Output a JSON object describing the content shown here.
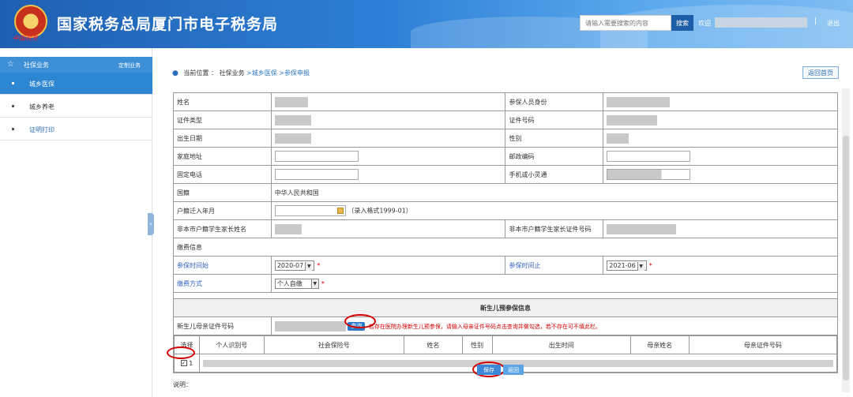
{
  "header": {
    "title": "国家税务总局厦门市电子税务局",
    "logo_caption": "中国税务",
    "search_placeholder": "请输入需要搜索的内容",
    "search_label": "搜索",
    "welcome": "欢迎",
    "separator": "|",
    "logout": "退出"
  },
  "sidebar": {
    "section": {
      "label": "社保业务",
      "custom": "定制业务"
    },
    "items": [
      {
        "label": "城乡医保"
      },
      {
        "label": "城乡养老"
      },
      {
        "label": "证明打印"
      }
    ],
    "toggle": "‹"
  },
  "breadcrumb": {
    "prefix": "当前位置 ：",
    "level1": "社保业务",
    "level2": ">城乡医保",
    "level3": ">参保申报"
  },
  "home_button": "返回首页",
  "form": {
    "name": "姓名",
    "identity": "参保人员身份",
    "id_type": "证件类型",
    "id_no": "证件号码",
    "birth": "出生日期",
    "gender": "性别",
    "address": "家庭地址",
    "postcode": "邮政编码",
    "phone": "固定电话",
    "mobile": "手机或小灵通",
    "nationality": "国籍",
    "nationality_value": "中华人民共和国",
    "hukou_date": "户籍迁入年月",
    "hukou_hint": "（录入格式1999-01）",
    "parent_name": "非本市户籍学生家长姓名",
    "parent_id": "非本市户籍学生家长证件号码",
    "payment_info": "缴费信息",
    "start_label": "参保时间始",
    "start_value": "2020-07",
    "end_label": "参保时间止",
    "end_value": "2021-06",
    "pay_method_label": "缴费方式",
    "pay_method_value": "个人自缴",
    "req_mark": "*"
  },
  "newborn": {
    "title": "新生儿预参保信息",
    "mother_id": "新生儿母亲证件号码",
    "query": "查询",
    "hint": "若存在医院办理新生儿预参保，请输入母亲证件号码点击查询并做勾选，若不存在可不填此栏。",
    "columns": [
      "选择",
      "个人识别号",
      "社会保险号",
      "姓名",
      "性别",
      "出生时间",
      "母亲姓名",
      "母亲证件号码"
    ],
    "row_index": "1",
    "checked": true
  },
  "actions": {
    "save": "保存",
    "back": "返回"
  },
  "notes": {
    "title": "说明："
  },
  "colors": {
    "header": "#2d7fd6",
    "accent": "#2f78c4",
    "highlight": "#d40000"
  }
}
